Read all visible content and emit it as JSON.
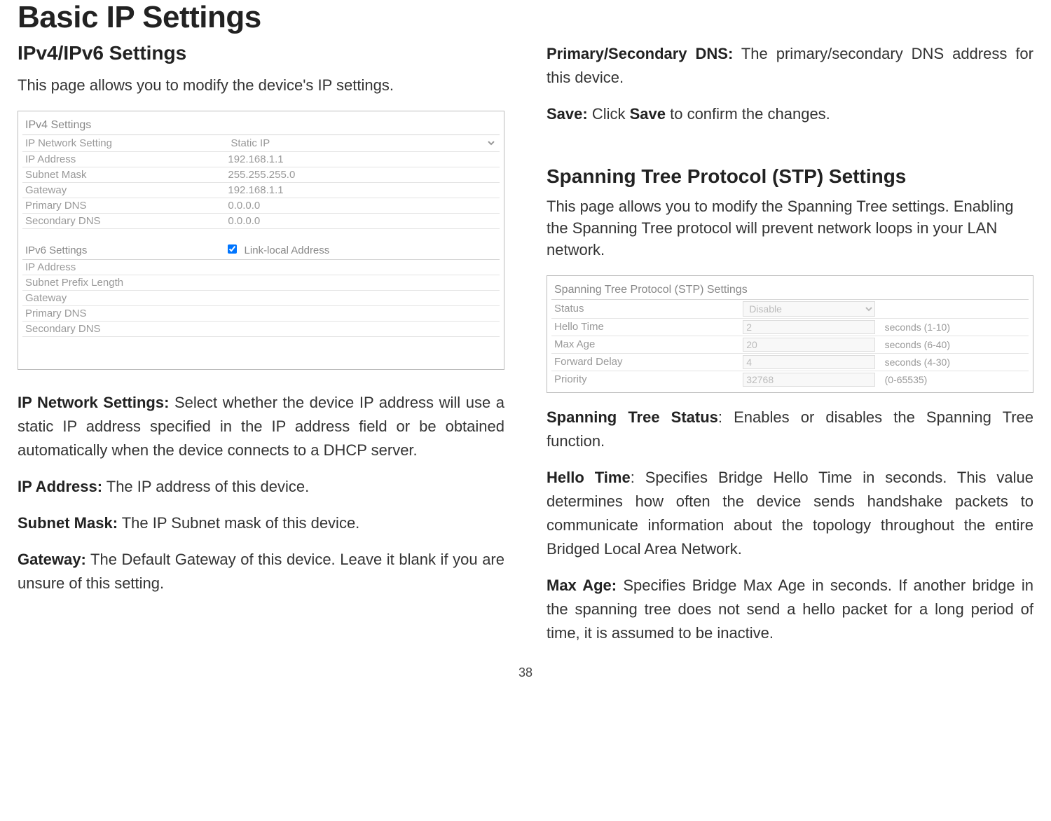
{
  "page_title": "Basic IP Settings",
  "page_number": "38",
  "left": {
    "heading1": "IPv4/IPv6 Settings",
    "intro": "This page allows you to modify the device's IP settings.",
    "panel": {
      "ipv4_title": "IPv4 Settings",
      "rows": {
        "ip_network_setting": {
          "label": "IP Network Setting",
          "value": "Static IP"
        },
        "ip_address": {
          "label": "IP Address",
          "value": "192.168.1.1"
        },
        "subnet_mask": {
          "label": "Subnet Mask",
          "value": "255.255.255.0"
        },
        "gateway": {
          "label": "Gateway",
          "value": "192.168.1.1"
        },
        "primary_dns": {
          "label": "Primary DNS",
          "value": "0.0.0.0"
        },
        "secondary_dns": {
          "label": "Secondary DNS",
          "value": "0.0.0.0"
        }
      },
      "ipv6_title": "IPv6 Settings",
      "ipv6_checkbox": "Link-local Address",
      "ipv6_rows": {
        "ip_address": {
          "label": "IP Address"
        },
        "subnet_prefix": {
          "label": "Subnet Prefix Length"
        },
        "gateway": {
          "label": "Gateway"
        },
        "primary_dns": {
          "label": "Primary DNS"
        },
        "secondary_dns": {
          "label": "Secondary DNS"
        }
      }
    },
    "defs": {
      "ip_network": {
        "label": "IP Network Settings:",
        "text": " Select whether the device IP address will use a static IP address specified in the IP address field or be obtained automatically when the device connects to a DHCP server."
      },
      "ip_address": {
        "label": "IP Address:",
        "text": " The IP address of this device."
      },
      "subnet_mask": {
        "label": "Subnet Mask:",
        "text": " The IP Subnet mask of this device."
      },
      "gateway": {
        "label": "Gateway:",
        "text": " The Default Gateway of this device. Leave it blank if you are unsure of this setting."
      }
    }
  },
  "right": {
    "defs1": {
      "dns": {
        "label": "Primary/Secondary DNS:",
        "text": " The primary/secondary DNS address for this device."
      },
      "save": {
        "label": "Save:",
        "text1": " Click ",
        "bold": "Save",
        "text2": " to confirm the changes."
      }
    },
    "heading2": "Spanning Tree Protocol (STP) Settings",
    "intro2": "This page allows you to modify the Spanning Tree settings. Enabling the Spanning Tree protocol will prevent network loops in your LAN network.",
    "panel": {
      "title": "Spanning Tree Protocol (STP) Settings",
      "rows": {
        "status": {
          "label": "Status",
          "value": "Disable"
        },
        "hello_time": {
          "label": "Hello Time",
          "value": "2",
          "hint": "seconds (1-10)"
        },
        "max_age": {
          "label": "Max Age",
          "value": "20",
          "hint": "seconds (6-40)"
        },
        "forward_delay": {
          "label": "Forward Delay",
          "value": "4",
          "hint": "seconds (4-30)"
        },
        "priority": {
          "label": "Priority",
          "value": "32768",
          "hint": "(0-65535)"
        }
      }
    },
    "defs2": {
      "status": {
        "label": "Spanning Tree Status",
        "text": ": Enables or disables the Spanning Tree function."
      },
      "hello": {
        "label": "Hello Time",
        "text": ": Specifies Bridge Hello Time in seconds. This value determines how often the device sends handshake packets to communicate information about the topology throughout the entire Bridged Local Area Network."
      },
      "maxage": {
        "label": "Max Age:",
        "text": " Specifies Bridge Max Age in seconds. If another bridge in the spanning tree does not send a hello packet for a long period of time, it is assumed to be inactive."
      }
    }
  }
}
